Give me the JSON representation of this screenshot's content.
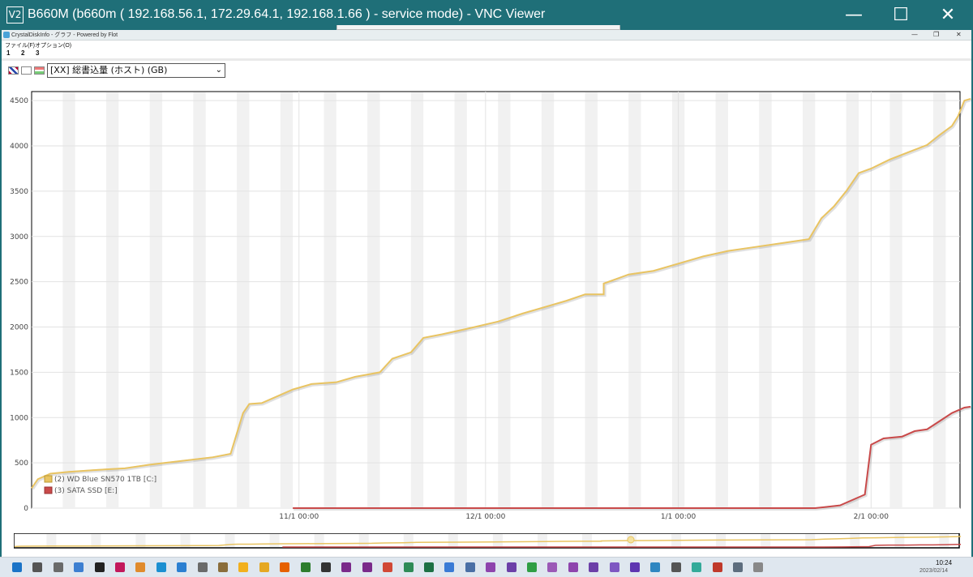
{
  "window": {
    "logo_text": "V2",
    "title": "B660M (b660m ( 192.168.56.1, 172.29.64.1, 192.168.1.66 ) - service mode) - VNC Viewer",
    "minimize_glyph": "—",
    "maximize_glyph": "☐",
    "close_glyph": "✕"
  },
  "app": {
    "title": "CrystalDiskInfo - グラフ - Powered by Flot",
    "minimize_glyph": "—",
    "restore_glyph": "❐",
    "close_glyph": "✕",
    "menu": [
      "ファイル(F)",
      "オプション(O)"
    ],
    "numbers": [
      "1",
      "2",
      "3"
    ],
    "toolbar_icons": [
      "flag-uk-icon",
      "blank-icon",
      "flag-jp-icon"
    ],
    "selector_value": "[XX] 総書込量 (ホスト) (GB)",
    "selector_arrow": "⌄"
  },
  "chart_data": {
    "type": "line",
    "title": "",
    "xlabel": "",
    "ylabel": "",
    "ylim": [
      0,
      4600
    ],
    "y_ticks": [
      0,
      500,
      1000,
      1500,
      2000,
      2500,
      3000,
      3500,
      4000,
      4500
    ],
    "x_tick_labels": [
      "11/1 00:00",
      "12/1 00:00",
      "1/1 00:00",
      "2/1 00:00"
    ],
    "x_range_days": [
      "2022-09-19",
      "2023-02-14"
    ],
    "x_tick_dates": [
      "2022-11-01",
      "2022-12-01",
      "2023-01-01",
      "2023-02-01"
    ],
    "grid": true,
    "legend_position": "bottom-left",
    "series": [
      {
        "name": "(2) WD Blue SN570 1TB [C:]",
        "color": "#e9c462",
        "points": [
          [
            "2022-09-19",
            220
          ],
          [
            "2022-09-20",
            320
          ],
          [
            "2022-09-22",
            380
          ],
          [
            "2022-09-25",
            400
          ],
          [
            "2022-09-29",
            420
          ],
          [
            "2022-10-04",
            440
          ],
          [
            "2022-10-08",
            480
          ],
          [
            "2022-10-13",
            520
          ],
          [
            "2022-10-18",
            560
          ],
          [
            "2022-10-21",
            600
          ],
          [
            "2022-10-23",
            1050
          ],
          [
            "2022-10-24",
            1150
          ],
          [
            "2022-10-26",
            1160
          ],
          [
            "2022-10-28",
            1220
          ],
          [
            "2022-10-31",
            1310
          ],
          [
            "2022-11-03",
            1370
          ],
          [
            "2022-11-07",
            1390
          ],
          [
            "2022-11-10",
            1450
          ],
          [
            "2022-11-14",
            1500
          ],
          [
            "2022-11-16",
            1650
          ],
          [
            "2022-11-19",
            1720
          ],
          [
            "2022-11-21",
            1880
          ],
          [
            "2022-11-24",
            1920
          ],
          [
            "2022-11-28",
            1980
          ],
          [
            "2022-12-03",
            2060
          ],
          [
            "2022-12-07",
            2150
          ],
          [
            "2022-12-11",
            2230
          ],
          [
            "2022-12-14",
            2290
          ],
          [
            "2022-12-17",
            2360
          ],
          [
            "2022-12-20",
            2360
          ],
          [
            "2022-12-20",
            2480
          ],
          [
            "2022-12-24",
            2580
          ],
          [
            "2022-12-28",
            2620
          ],
          [
            "2023-01-01",
            2700
          ],
          [
            "2023-01-05",
            2780
          ],
          [
            "2023-01-09",
            2840
          ],
          [
            "2023-01-13",
            2880
          ],
          [
            "2023-01-18",
            2930
          ],
          [
            "2023-01-22",
            2970
          ],
          [
            "2023-01-24",
            3200
          ],
          [
            "2023-01-26",
            3330
          ],
          [
            "2023-01-28",
            3500
          ],
          [
            "2023-01-30",
            3700
          ],
          [
            "2023-02-01",
            3750
          ],
          [
            "2023-02-04",
            3850
          ],
          [
            "2023-02-07",
            3930
          ],
          [
            "2023-02-10",
            4010
          ],
          [
            "2023-02-12",
            4120
          ],
          [
            "2023-02-14",
            4220
          ],
          [
            "2023-02-15",
            4330
          ],
          [
            "2023-02-16",
            4500
          ],
          [
            "2023-02-17",
            4520
          ]
        ]
      },
      {
        "name": "(3) SATA SSD [E:]",
        "color": "#c94a4a",
        "points": [
          [
            "2022-10-31",
            0
          ],
          [
            "2023-01-23",
            0
          ],
          [
            "2023-01-27",
            30
          ],
          [
            "2023-01-31",
            150
          ],
          [
            "2023-02-01",
            700
          ],
          [
            "2023-02-03",
            770
          ],
          [
            "2023-02-06",
            790
          ],
          [
            "2023-02-08",
            850
          ],
          [
            "2023-02-10",
            870
          ],
          [
            "2023-02-12",
            960
          ],
          [
            "2023-02-14",
            1050
          ],
          [
            "2023-02-16",
            1110
          ],
          [
            "2023-02-17",
            1120
          ]
        ]
      }
    ]
  },
  "taskbar": {
    "icons": [
      "start-icon",
      "file-icon",
      "settings-icon",
      "monitor-icon",
      "terminal-icon",
      "paint-icon",
      "app-icon",
      "edge-icon",
      "network-icon",
      "settings-icon",
      "box-icon",
      "folder-icon",
      "folder-icon",
      "firefox-icon",
      "vnc-icon",
      "terminal-icon",
      "vs-icon",
      "vs-icon",
      "git-icon",
      "sync-icon",
      "excel-icon",
      "cloud-icon",
      "monitor-icon",
      "vs-icon",
      "vs-icon",
      "arrow-icon",
      "vs-icon",
      "vs-icon",
      "vs-icon",
      "vs-icon",
      "vs-icon",
      "shield-icon",
      "tool-icon",
      "app-icon",
      "chart-icon",
      "app-icon",
      "tool-icon"
    ],
    "time": "10:24",
    "date": "2023/02/14"
  }
}
